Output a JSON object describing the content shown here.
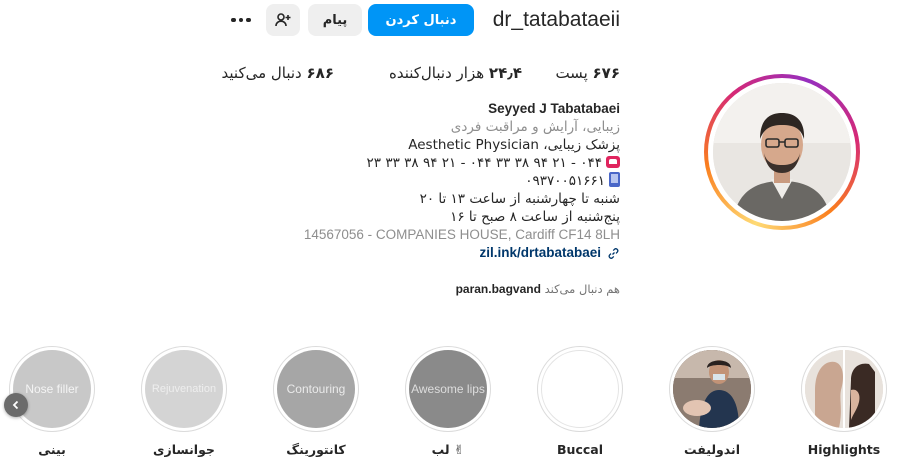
{
  "header": {
    "username": "dr_tatabataeii",
    "follow_label": "دنبال کردن",
    "message_label": "پیام"
  },
  "stats": {
    "posts_count": "۶۷۶",
    "posts_label": "پست",
    "followers_count": "۲۴٫۴",
    "followers_label": "هزار دنبال‌کننده",
    "following_count": "۶۸۶",
    "following_label": "دنبال می‌کنید"
  },
  "bio": {
    "name": "Seyyed J Tabatabaei",
    "category": "زیبایی، آرایش و مراقبت فردی",
    "line1": "پزشک زیبایی، Aesthetic Physician",
    "line2": "۰۴۴ - ۲۱ ۹۴ ۳۸ ۳۳ ۰۴۴ - ۲۱ ۹۴ ۳۸ ۳۳ ۲۳",
    "line3": "۰۹۳۷۰۰۵۱۶۶۱",
    "line4": "شنبه تا چهارشنبه از ساعت ۱۳ تا ۲۰",
    "line5": "پنج‌شنبه از ساعت ۸ صبح تا ۱۶",
    "address": "14567056 - COMPANIES HOUSE, Cardiff CF14 8LH",
    "link": "zil.ink/drtabatabaei"
  },
  "followed_by": {
    "prefix": "هم دنبال می‌کند",
    "user": "paran.bagvand"
  },
  "highlights": [
    {
      "label": "Highlights",
      "image_text": ""
    },
    {
      "label": "اندولیفت",
      "image_text": ""
    },
    {
      "label": "Buccal",
      "image_text": ""
    },
    {
      "label": "لب ✌",
      "image_text": "Awesome lips"
    },
    {
      "label": "کانتورینگ",
      "image_text": "Contouring"
    },
    {
      "label": "جوانسازی",
      "image_text": "Rejuvenation"
    },
    {
      "label": "بینی",
      "image_text": "Nose filler"
    }
  ],
  "colors": {
    "primary_button": "#0095f6",
    "secondary_button": "#efefef",
    "link": "#00376b",
    "muted_text": "#8e8e8e"
  }
}
